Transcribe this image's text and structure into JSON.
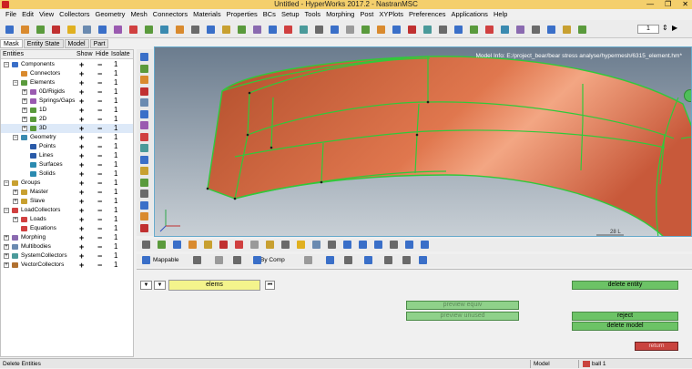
{
  "window": {
    "title": "Untitled - HyperWorks 2017.2 - NastranMSC",
    "minimize": "—",
    "maximize": "❐",
    "close": "✕"
  },
  "menu": [
    "File",
    "Edit",
    "View",
    "Collectors",
    "Geometry",
    "Mesh",
    "Connectors",
    "Materials",
    "Properties",
    "BCs",
    "Setup",
    "Tools",
    "Morphing",
    "Post",
    "XYPlots",
    "Preferences",
    "Applications",
    "Help"
  ],
  "toolbar": {
    "page_field": "1"
  },
  "browser_tabs": [
    "Mask",
    "Entity State",
    "Model",
    "Part"
  ],
  "browser_headers": {
    "entities": "Entities",
    "show": "Show",
    "hide": "Hide",
    "isolate": "Isolate"
  },
  "tree": [
    {
      "label": "Components",
      "level": 0,
      "toggle": "−",
      "icon": "#3a6fc8",
      "one": "1"
    },
    {
      "label": "Connectors",
      "level": 1,
      "toggle": "",
      "icon": "#d98a2e",
      "one": "1"
    },
    {
      "label": "Elements",
      "level": 1,
      "toggle": "−",
      "icon": "#5a9a3c",
      "one": "1"
    },
    {
      "label": "0D/Rigids",
      "level": 2,
      "toggle": "+",
      "icon": "#9a5ab0",
      "one": "1"
    },
    {
      "label": "Springs/Gaps",
      "level": 2,
      "toggle": "+",
      "icon": "#9a5ab0",
      "one": "1"
    },
    {
      "label": "1D",
      "level": 2,
      "toggle": "+",
      "icon": "#5a9a3c",
      "one": "1"
    },
    {
      "label": "2D",
      "level": 2,
      "toggle": "+",
      "icon": "#5a9a3c",
      "one": "1"
    },
    {
      "label": "3D",
      "level": 2,
      "toggle": "+",
      "icon": "#5a9a3c",
      "one": "1",
      "selected": true
    },
    {
      "label": "Geometry",
      "level": 1,
      "toggle": "−",
      "icon": "#3a8ab0",
      "one": "1"
    },
    {
      "label": "Points",
      "level": 2,
      "toggle": "",
      "icon": "#2a5aa8",
      "one": "1"
    },
    {
      "label": "Lines",
      "level": 2,
      "toggle": "",
      "icon": "#2a5aa8",
      "one": "1"
    },
    {
      "label": "Surfaces",
      "level": 2,
      "toggle": "",
      "icon": "#2a8ab0",
      "one": "1"
    },
    {
      "label": "Solids",
      "level": 2,
      "toggle": "",
      "icon": "#2a8ab0",
      "one": "1"
    },
    {
      "label": "Groups",
      "level": 0,
      "toggle": "−",
      "icon": "#c8a030",
      "one": "1"
    },
    {
      "label": "Master",
      "level": 1,
      "toggle": "+",
      "icon": "#c8a030",
      "one": "1"
    },
    {
      "label": "Slave",
      "level": 1,
      "toggle": "+",
      "icon": "#c8a030",
      "one": "1"
    },
    {
      "label": "LoadCollectors",
      "level": 0,
      "toggle": "−",
      "icon": "#d04040",
      "one": "1"
    },
    {
      "label": "Loads",
      "level": 1,
      "toggle": "+",
      "icon": "#d04040",
      "one": "1"
    },
    {
      "label": "Equations",
      "level": 1,
      "toggle": "",
      "icon": "#d04040",
      "one": "1"
    },
    {
      "label": "Morphing",
      "level": 0,
      "toggle": "+",
      "icon": "#8a6ab0",
      "one": "1"
    },
    {
      "label": "Multibodies",
      "level": 0,
      "toggle": "+",
      "icon": "#6a8ab0",
      "one": "1"
    },
    {
      "label": "SystemCollectors",
      "level": 0,
      "toggle": "+",
      "icon": "#4a9a9a",
      "one": "1"
    },
    {
      "label": "VectorCollectors",
      "level": 0,
      "toggle": "+",
      "icon": "#b07030",
      "one": "1"
    }
  ],
  "viewport": {
    "model_info": "Model Info: E:/project_bear/bear stress analyse/hypermesh/6315_element.hm*",
    "scale_label": "28 L",
    "gradient_top": "#6b7c8e",
    "gradient_bottom": "#c9d0d6",
    "part_color": "#d56a43",
    "edge_color": "#31c93a"
  },
  "bottombar": {
    "mapping_label": "Mappable",
    "color_label": "By Comp"
  },
  "panel": {
    "entity_selector": "elems",
    "preview_equiv": "preview equiv",
    "preview_unused": "preview unused",
    "delete_entity": "delete entity",
    "reject": "reject",
    "delete_model": "delete model",
    "return": "return"
  },
  "status": {
    "left": "Delete Entities",
    "model": "Model",
    "component": "ball 1"
  },
  "colors": {
    "accent_green": "#6cc366",
    "return_red": "#c9433e",
    "titlebar": "#f4cf6c"
  }
}
